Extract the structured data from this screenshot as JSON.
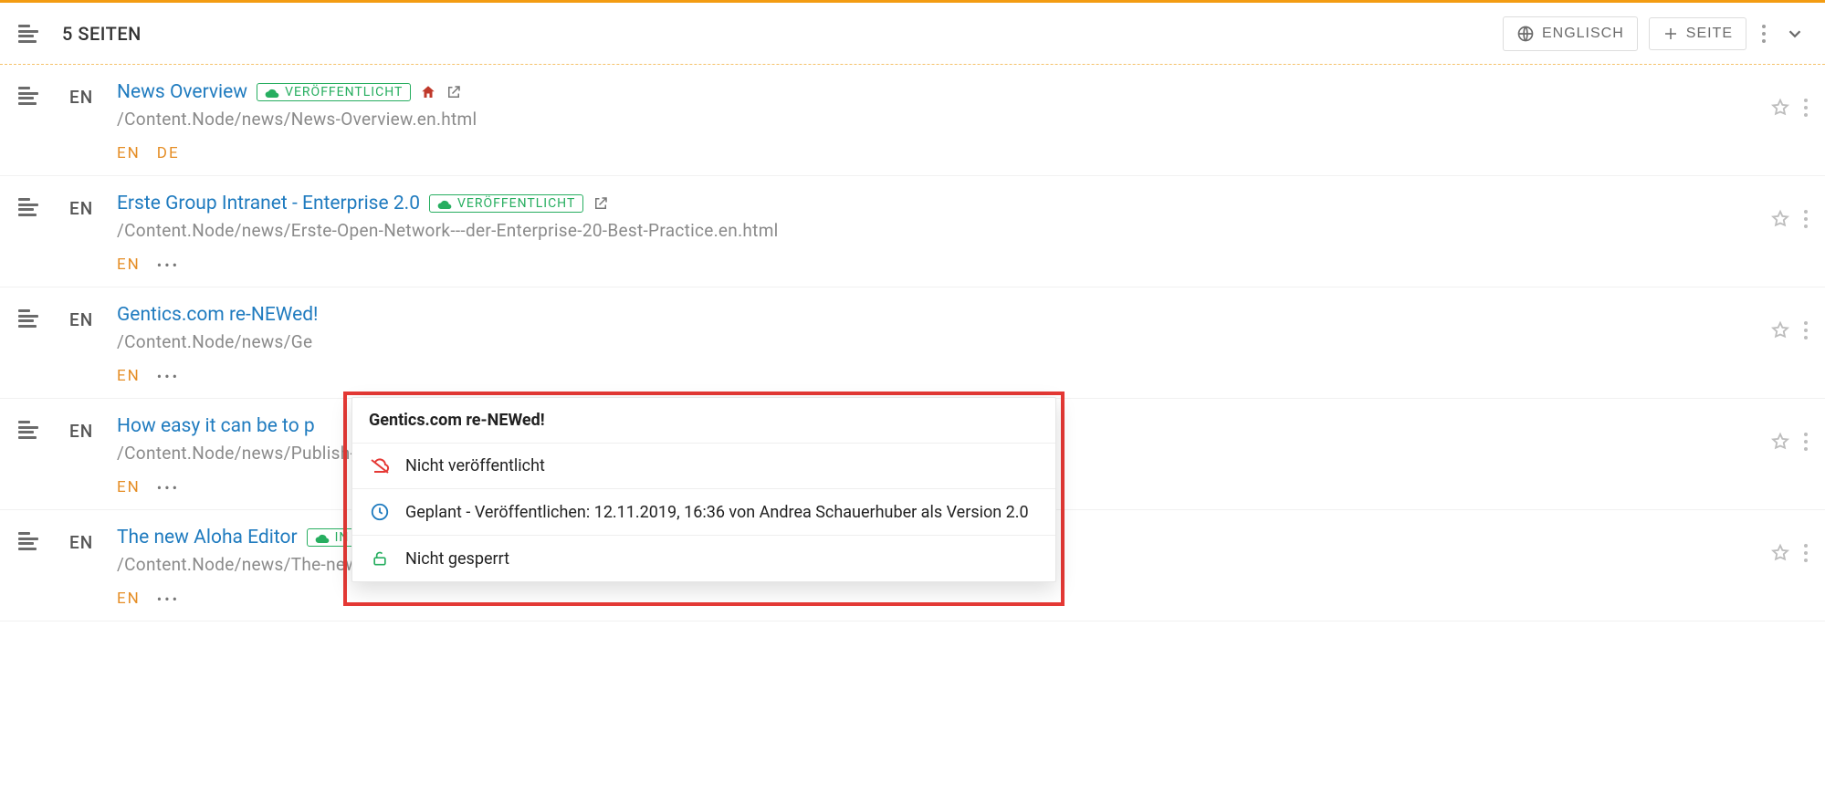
{
  "toolbar": {
    "title": "5 SEITEN",
    "lang_btn": "ENGLISCH",
    "add_btn": "SEITE"
  },
  "statuses": {
    "published": "VERÖFFENTLICHT",
    "in_queue": "IN WARTESCHLANGE *"
  },
  "rows": [
    {
      "lang": "EN",
      "title": "News Overview",
      "status_key": "published",
      "home": true,
      "path": "/Content.Node/news/News-Overview.en.html",
      "langs": [
        "EN",
        "DE"
      ],
      "more": false
    },
    {
      "lang": "EN",
      "title": "Erste Group Intranet - Enterprise 2.0",
      "status_key": "published",
      "home": false,
      "path": "/Content.Node/news/Erste-Open-Network---der-Enterprise-20-Best-Practice.en.html",
      "langs": [
        "EN"
      ],
      "more": true
    },
    {
      "lang": "EN",
      "title": "Gentics.com re-NEWed!",
      "status_key": null,
      "home": false,
      "path": "/Content.Node/news/Ge",
      "langs": [
        "EN"
      ],
      "more": true
    },
    {
      "lang": "EN",
      "title": "How easy it can be to p",
      "status_key": null,
      "home": false,
      "path": "/Content.Node/news/Publish-news.html",
      "langs": [
        "EN"
      ],
      "more": true
    },
    {
      "lang": "EN",
      "title": "The new Aloha Editor",
      "status_key": "in_queue",
      "home": false,
      "path": "/Content.Node/news/The-new-Aloha-Editor.en.html",
      "langs": [
        "EN"
      ],
      "more": true
    }
  ],
  "popover": {
    "title": "Gentics.com re-NEWed!",
    "line1": "Nicht veröffentlicht",
    "line2": "Geplant - Veröffentlichen: 12.11.2019, 16:36 von Andrea Schauerhuber als Version 2.0",
    "line3": "Nicht gesperrt"
  }
}
